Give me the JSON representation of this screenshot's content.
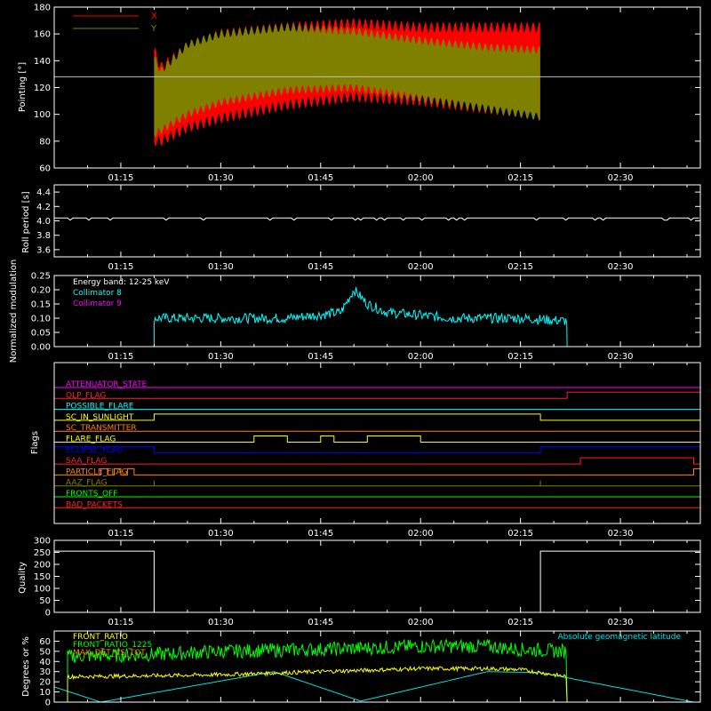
{
  "time_ticks": [
    "01:15",
    "01:30",
    "01:45",
    "02:00",
    "02:15",
    "02:30"
  ],
  "chart_data": [
    {
      "type": "line",
      "ylabel": "Pointing [°]",
      "ylim": [
        60,
        180
      ],
      "yticks": [
        60,
        80,
        100,
        120,
        140,
        160,
        180
      ],
      "x_range": [
        "01:05",
        "02:42"
      ],
      "legend_placement": "top-left",
      "reference_line": 128,
      "series": [
        {
          "name": "X",
          "color": "#ff0000",
          "t": [
            "01:20",
            "01:21",
            "01:25",
            "01:30",
            "01:40",
            "01:50",
            "02:00",
            "02:10",
            "02:18"
          ],
          "upper": [
            148,
            135,
            150,
            160,
            165,
            168,
            165,
            165,
            165
          ],
          "lower": [
            80,
            80,
            90,
            97,
            107,
            113,
            110,
            104,
            100
          ]
        },
        {
          "name": "Y",
          "color": "#808000",
          "t": [
            "01:20",
            "01:21",
            "01:25",
            "01:30",
            "01:40",
            "01:50",
            "02:00",
            "02:10",
            "02:18"
          ],
          "upper": [
            142,
            132,
            152,
            160,
            165,
            162,
            155,
            150,
            148
          ],
          "lower": [
            85,
            88,
            100,
            109,
            118,
            120,
            112,
            104,
            98
          ]
        }
      ]
    },
    {
      "type": "line",
      "ylabel": "Roll period [s]",
      "ylim": [
        3.5,
        4.5
      ],
      "yticks": [
        3.6,
        3.8,
        4.0,
        4.2,
        4.4
      ],
      "series": [
        {
          "color": "#ffffff",
          "t": [
            "01:05",
            "02:42"
          ],
          "values": [
            4.04,
            4.04
          ]
        }
      ]
    },
    {
      "type": "line",
      "ylabel": "Normalized modulation",
      "ylim": [
        0,
        0.25
      ],
      "yticks": [
        0.0,
        0.05,
        0.1,
        0.15,
        0.2,
        0.25
      ],
      "annotation": "Energy band: 12-25 keV",
      "series": [
        {
          "name": "Collimator 8",
          "color": "#00ffff",
          "t": [
            "01:20",
            "01:30",
            "01:40",
            "01:48",
            "01:50",
            "01:52",
            "01:55",
            "02:05",
            "02:15",
            "02:22"
          ],
          "values": [
            0.1,
            0.1,
            0.1,
            0.12,
            0.2,
            0.15,
            0.12,
            0.1,
            0.1,
            0.09
          ]
        },
        {
          "name": "Collimator 9",
          "color": "#ff00ff",
          "t": [
            "01:05",
            "02:42"
          ],
          "values": [
            0.0,
            0.0
          ]
        }
      ]
    },
    {
      "type": "line",
      "ylabel": "Flags",
      "series": [
        {
          "name": "ATTENUATOR_STATE",
          "color": "#ff00ff"
        },
        {
          "name": "QLP_FLAG",
          "color": "#ff2020"
        },
        {
          "name": "POSSIBLE_FLARE",
          "color": "#00ffff"
        },
        {
          "name": "SC_IN_SUNLIGHT",
          "color": "#ffff00"
        },
        {
          "name": "SC_TRANSMITTER",
          "color": "#ff8000"
        },
        {
          "name": "FLARE_FLAG",
          "color": "#ffff00"
        },
        {
          "name": "ECLIPSE_FLAG",
          "color": "#0000ff"
        },
        {
          "name": "SAA_FLAG",
          "color": "#ff2020"
        },
        {
          "name": "PARTICLE_FLAG",
          "color": "#ff8000"
        },
        {
          "name": "AAZ_FLAG",
          "color": "#808000"
        },
        {
          "name": "FRONTS_OFF",
          "color": "#00ff00"
        },
        {
          "name": "BAD_PACKETS",
          "color": "#ff2020"
        }
      ]
    },
    {
      "type": "line",
      "ylabel": "Quality",
      "ylim": [
        0,
        300
      ],
      "yticks": [
        0,
        50,
        100,
        150,
        200,
        250,
        300
      ],
      "series": [
        {
          "color": "#ffffff",
          "t": [
            "01:05",
            "01:20",
            "01:20",
            "02:18",
            "02:18",
            "02:42"
          ],
          "values": [
            255,
            255,
            0,
            0,
            255,
            255
          ]
        }
      ]
    },
    {
      "type": "line",
      "ylabel": "Degrees or %",
      "ylim": [
        0,
        70
      ],
      "yticks": [
        0,
        10,
        20,
        30,
        40,
        50,
        60
      ],
      "series": [
        {
          "name": "FRONT_RATIO",
          "color": "#ffff00",
          "t": [
            "01:07",
            "01:20",
            "01:30",
            "01:45",
            "02:00",
            "02:10",
            "02:15",
            "02:22"
          ],
          "values": [
            25,
            26,
            27,
            30,
            33,
            33,
            32,
            25
          ]
        },
        {
          "name": "FRONT_RATIO_1225",
          "color": "#00ff00",
          "t": [
            "01:07",
            "01:20",
            "01:30",
            "01:45",
            "02:00",
            "02:10",
            "02:15",
            "02:22"
          ],
          "values": [
            45,
            47,
            50,
            52,
            55,
            55,
            52,
            50
          ]
        },
        {
          "name": "MAX_DET_VS_TOT",
          "color": "#ff8000",
          "t": [],
          "values": []
        },
        {
          "name": "Absolute geomagnetic latitude",
          "color": "#00e0e0",
          "t": [
            "01:05",
            "01:12",
            "01:38",
            "01:51",
            "02:10",
            "02:18",
            "02:41"
          ],
          "values": [
            15,
            0,
            30,
            1,
            30,
            29,
            0
          ]
        }
      ]
    }
  ]
}
